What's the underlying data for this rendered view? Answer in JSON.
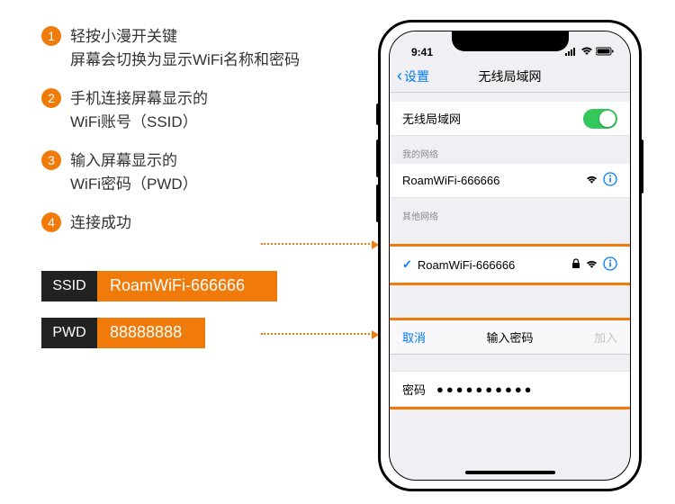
{
  "steps": [
    {
      "num": "1",
      "text": "轻按小漫开关键\n屏幕会切换为显示WiFi名称和密码"
    },
    {
      "num": "2",
      "text": "手机连接屏幕显示的\nWiFi账号（SSID）"
    },
    {
      "num": "3",
      "text": "输入屏幕显示的\nWiFi密码（PWD）"
    },
    {
      "num": "4",
      "text": "连接成功"
    }
  ],
  "creds": {
    "ssid_label": "SSID",
    "ssid_value": "RoamWiFi-666666",
    "pwd_label": "PWD",
    "pwd_value": "88888888"
  },
  "phone": {
    "status_time": "9:41",
    "nav_back": "设置",
    "nav_title": "无线局域网",
    "wifi_row_label": "无线局域网",
    "my_networks_header": "我的网络",
    "my_network_name": "RoamWiFi-666666",
    "other_networks_header": "其他网络",
    "selected_network": "RoamWiFi-666666",
    "pwd_dialog": {
      "cancel": "取消",
      "title": "输入密码",
      "join": "加入",
      "field_label": "密码",
      "dots": "●●●●●●●●●●"
    }
  }
}
